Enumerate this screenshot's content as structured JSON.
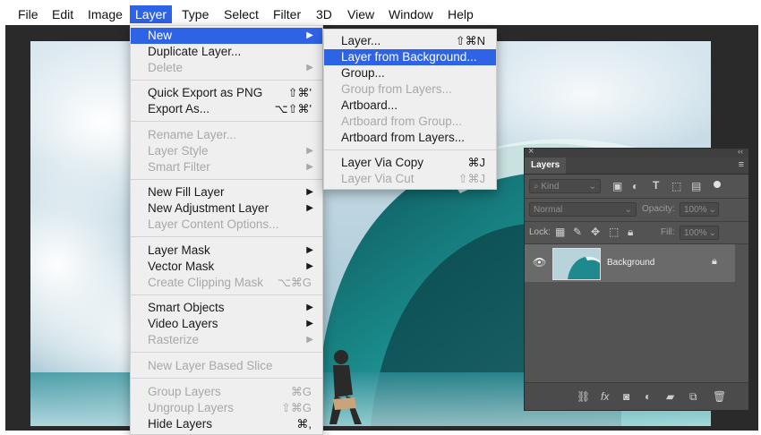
{
  "menubar": {
    "items": [
      "File",
      "Edit",
      "Image",
      "Layer",
      "Type",
      "Select",
      "Filter",
      "3D",
      "View",
      "Window",
      "Help"
    ]
  },
  "layer_menu": {
    "items": [
      {
        "label": "New",
        "highlighted": true,
        "submenu": true
      },
      {
        "label": "Duplicate Layer..."
      },
      {
        "label": "Delete",
        "disabled": true,
        "submenu": true
      },
      {
        "label": "Quick Export as PNG",
        "shortcut": "⇧⌘'"
      },
      {
        "label": "Export As...",
        "shortcut": "⌥⇧⌘'"
      },
      {
        "label": "Rename Layer...",
        "disabled": true
      },
      {
        "label": "Layer Style",
        "disabled": true,
        "submenu": true
      },
      {
        "label": "Smart Filter",
        "disabled": true,
        "submenu": true
      },
      {
        "label": "New Fill Layer",
        "submenu": true
      },
      {
        "label": "New Adjustment Layer",
        "submenu": true
      },
      {
        "label": "Layer Content Options...",
        "disabled": true
      },
      {
        "label": "Layer Mask",
        "submenu": true
      },
      {
        "label": "Vector Mask",
        "submenu": true
      },
      {
        "label": "Create Clipping Mask",
        "disabled": true,
        "shortcut": "⌥⌘G"
      },
      {
        "label": "Smart Objects",
        "submenu": true
      },
      {
        "label": "Video Layers",
        "submenu": true
      },
      {
        "label": "Rasterize",
        "disabled": true,
        "submenu": true
      },
      {
        "label": "New Layer Based Slice",
        "disabled": true
      },
      {
        "label": "Group Layers",
        "disabled": true,
        "shortcut": "⌘G"
      },
      {
        "label": "Ungroup Layers",
        "disabled": true,
        "shortcut": "⇧⌘G"
      },
      {
        "label": "Hide Layers",
        "shortcut": "⌘,"
      }
    ]
  },
  "new_submenu": {
    "items": [
      {
        "label": "Layer...",
        "shortcut": "⇧⌘N"
      },
      {
        "label": "Layer from Background...",
        "highlighted": true
      },
      {
        "label": "Group..."
      },
      {
        "label": "Group from Layers...",
        "disabled": true
      },
      {
        "label": "Artboard..."
      },
      {
        "label": "Artboard from Group...",
        "disabled": true
      },
      {
        "label": "Artboard from Layers..."
      },
      {
        "label": "Layer Via Copy",
        "shortcut": "⌘J"
      },
      {
        "label": "Layer Via Cut",
        "disabled": true,
        "shortcut": "⇧⌘J"
      }
    ]
  },
  "layers_panel": {
    "tab": "Layers",
    "filter_kind": "Kind",
    "blend_mode": "Normal",
    "opacity_label": "Opacity:",
    "opacity_value": "100%",
    "lock_label": "Lock:",
    "fill_label": "Fill:",
    "fill_value": "100%",
    "layer_name": "Background",
    "close_glyph": "×",
    "collapse_glyph": "‹‹"
  },
  "colors": {
    "accent": "#2f63e6",
    "menu_bg": "#efefef",
    "panel_bg": "#535353",
    "workspace_bg": "#2a2a2a"
  }
}
